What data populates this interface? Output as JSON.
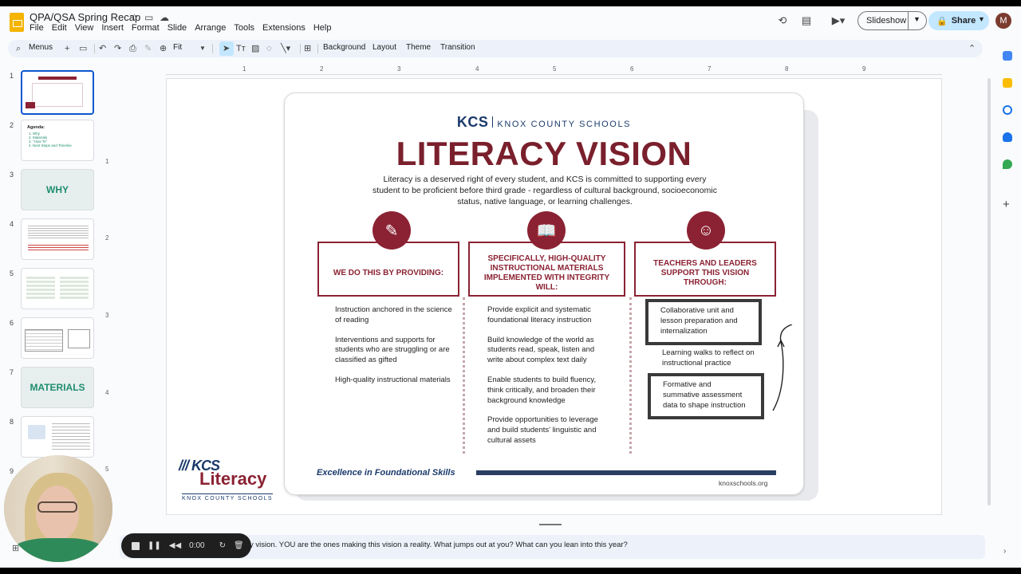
{
  "header": {
    "doc_title": "QPA/QSA Spring Recap",
    "menu_items": [
      "File",
      "Edit",
      "View",
      "Insert",
      "Format",
      "Slide",
      "Arrange",
      "Tools",
      "Extensions",
      "Help"
    ],
    "slideshow_label": "Slideshow",
    "share_label": "Share",
    "avatar_initial": "M"
  },
  "toolbar": {
    "menus_label": "Menus",
    "zoom_value": "Fit",
    "background_label": "Background",
    "layout_label": "Layout",
    "theme_label": "Theme",
    "transition_label": "Transition"
  },
  "ruler": {
    "h_ticks": [
      "1",
      "2",
      "3",
      "4",
      "5",
      "6",
      "7",
      "8",
      "9"
    ],
    "v_ticks": [
      "1",
      "2",
      "3",
      "4",
      "5"
    ]
  },
  "filmstrip": [
    {
      "num": "1",
      "big": ""
    },
    {
      "num": "2",
      "big": ""
    },
    {
      "num": "3",
      "big": "WHY"
    },
    {
      "num": "4",
      "big": ""
    },
    {
      "num": "5",
      "big": ""
    },
    {
      "num": "6",
      "big": ""
    },
    {
      "num": "7",
      "big": "MATERIALS"
    },
    {
      "num": "8",
      "big": ""
    },
    {
      "num": "9",
      "big": ""
    }
  ],
  "thumb2": {
    "title": "Agenda:",
    "items": [
      "1. Why",
      "2. Materials",
      "3. \"How To\"",
      "4. Next Steps and Timeline"
    ]
  },
  "poster": {
    "kcs": "KCS",
    "kcs_full": "KNOX COUNTY SCHOOLS",
    "title": "LITERACY VISION",
    "intro": "Literacy is a deserved right of every student, and KCS is committed to supporting every student to be proficient before third grade - regardless of cultural background, socioeconomic status, native language, or learning challenges.",
    "col1": {
      "heading": "WE DO THIS BY PROVIDING:",
      "items": [
        "Instruction anchored in the science of reading",
        "Interventions and supports  for students who are struggling or are classified  as gifted",
        "High-quality instructional materials"
      ]
    },
    "col2": {
      "heading": "SPECIFICALLY, HIGH-QUALITY INSTRUCTIONAL MATERIALS IMPLEMENTED WITH INTEGRITY WILL:",
      "items": [
        "Provide explicit and systematic foundational literacy instruction",
        "Build knowledge of the world as students read, speak, listen and write about complex text daily",
        "Enable students to build fluency, think critically, and broaden their background knowledge",
        "Provide opportunities to leverage and build students' linguistic and cultural assets"
      ]
    },
    "col3": {
      "heading": "TEACHERS AND LEADERS SUPPORT THIS VISION THROUGH:",
      "box1": "Collaborative unit and lesson preparation and internalization",
      "middle": "Learning walks to reflect on instructional practice",
      "box2": "Formative and summative assessment data to shape instruction"
    },
    "footer_tagline": "Excellence in Foundational Skills",
    "footer_url": "knoxschools.org"
  },
  "kcs_literacy_logo": {
    "kcs": "KCS",
    "literacy": "Literacy",
    "sub": "KNOX COUNTY SCHOOLS"
  },
  "notes": {
    "text": "y vision. YOU are the ones making this vision a reality. What jumps out at you? What can you lean into this year?"
  },
  "recorder": {
    "time": "0:00"
  },
  "colors": {
    "maroon": "#8b2233",
    "navy": "#1b3a6b",
    "accent_blue": "#0b57d0",
    "share_bg": "#c2e7ff"
  }
}
